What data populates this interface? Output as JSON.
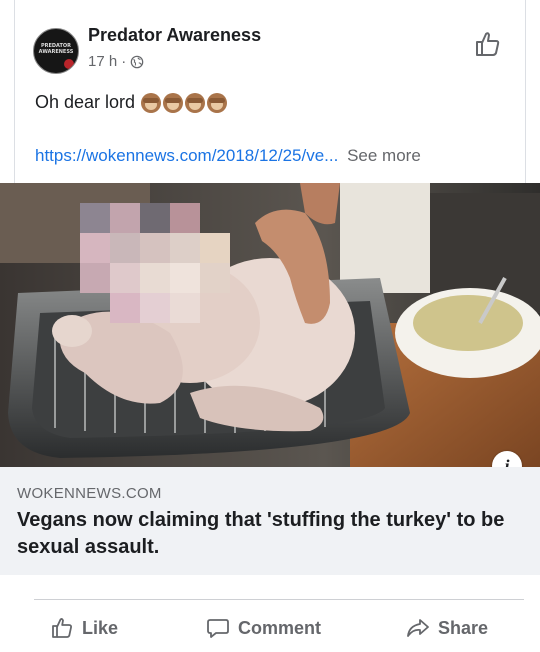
{
  "post": {
    "author": "Predator Awareness",
    "avatar_text": "PREDATOR AWARENESS",
    "time": "17 h",
    "separator": "·",
    "text": "Oh dear lord",
    "emoji_count": 4,
    "link_text": "https://wokennews.com/2018/12/25/ve...",
    "see_more": "See more"
  },
  "preview": {
    "domain": "WOKENNEWS.COM",
    "title": "Vegans now claiming that 'stuffing the turkey' to be sexual assault."
  },
  "actions": {
    "like": "Like",
    "comment": "Comment",
    "share": "Share"
  },
  "colors": {
    "link": "#1b74e4",
    "secondary_text": "#65676b",
    "preview_bg": "#f0f2f5"
  },
  "icons": {
    "header_like": "thumbs-up-outline-icon",
    "audience": "globe-icon",
    "info": "info-icon",
    "emoji": "see-no-evil-monkey"
  }
}
